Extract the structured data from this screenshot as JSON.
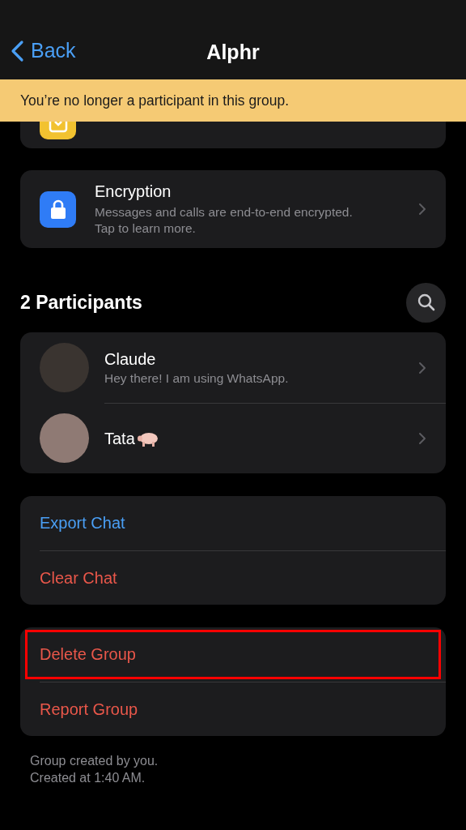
{
  "nav": {
    "back": "Back",
    "title": "Alphr"
  },
  "banner": "You’re no longer a participant in this group.",
  "settings": [
    {
      "kind": "camera"
    },
    {
      "kind": "lock",
      "label": "Encryption",
      "description": "Messages and calls are end-to-end encrypted. Tap to learn more."
    }
  ],
  "participants": {
    "title": "2 Participants",
    "items": [
      {
        "name": "Claude",
        "status": "Hey there! I am using WhatsApp.",
        "color": "#3a3430",
        "kind": "plain"
      },
      {
        "name": "Tata",
        "color": "#8f7a74",
        "kind": "pig"
      }
    ]
  },
  "action_groups": [
    [
      {
        "label": "Export Chat",
        "kind": "link",
        "highlighted": false
      },
      {
        "label": "Clear Chat",
        "kind": "destructive",
        "highlighted": false
      }
    ],
    [
      {
        "label": "Delete Group",
        "kind": "destructive",
        "highlighted": true
      },
      {
        "label": "Report Group",
        "kind": "destructive",
        "highlighted": false
      }
    ]
  ],
  "footer": [
    "Group created by you.",
    "Created at 1:40 AM."
  ]
}
